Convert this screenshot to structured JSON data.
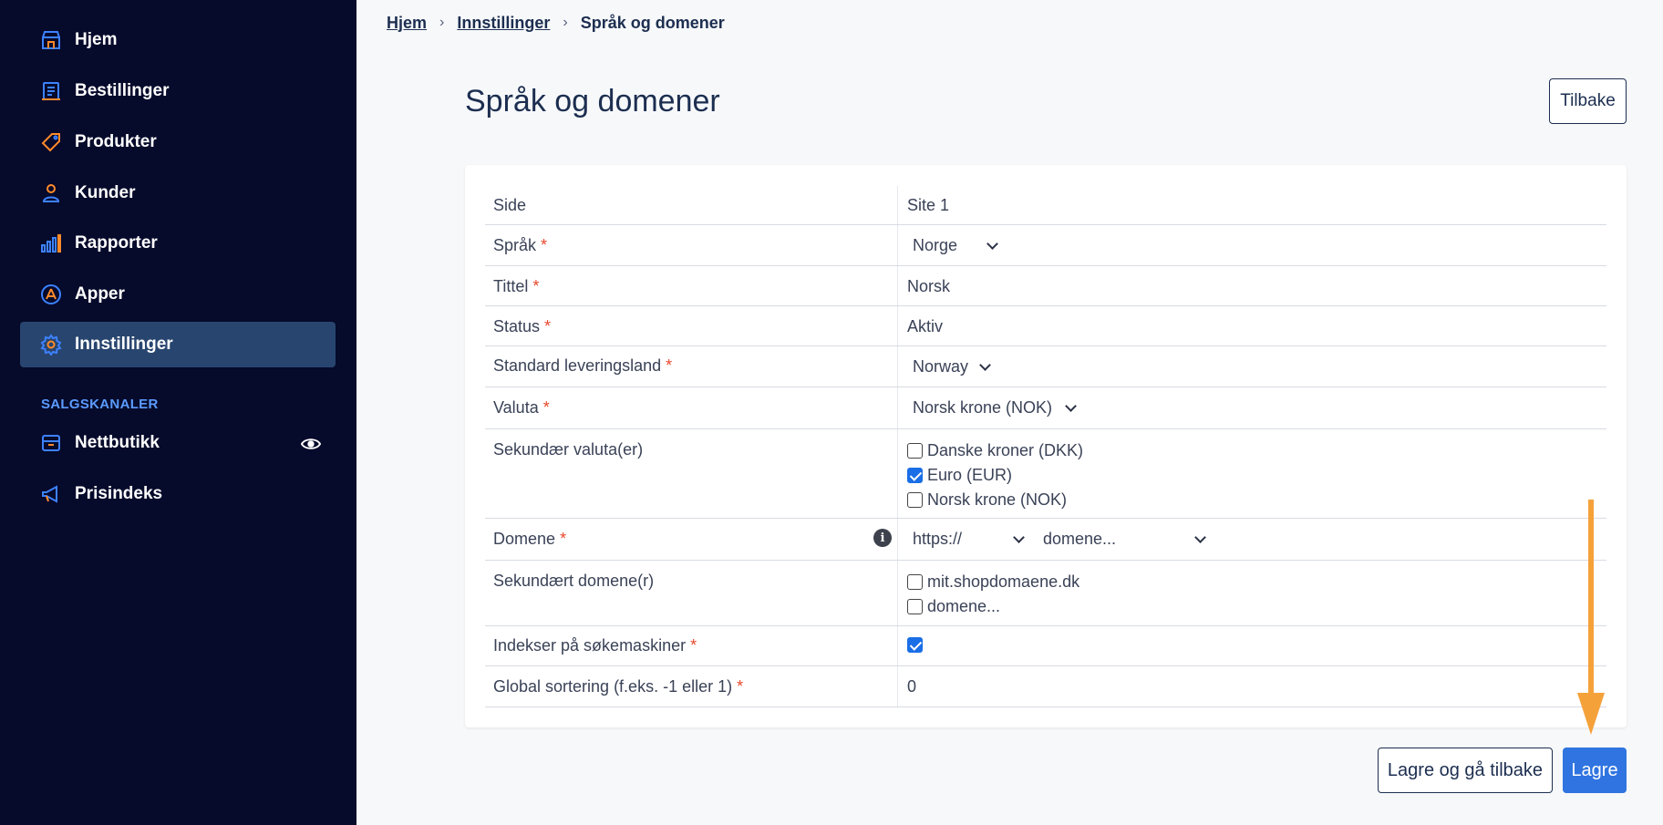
{
  "sidebar": {
    "items": [
      {
        "label": "Hjem",
        "icon": "store-icon"
      },
      {
        "label": "Bestillinger",
        "icon": "orders-icon"
      },
      {
        "label": "Produkter",
        "icon": "tag-icon"
      },
      {
        "label": "Kunder",
        "icon": "user-icon"
      },
      {
        "label": "Rapporter",
        "icon": "bar-chart-icon"
      },
      {
        "label": "Apper",
        "icon": "apps-icon"
      },
      {
        "label": "Innstillinger",
        "icon": "gear-icon",
        "active": true
      }
    ],
    "section_title": "SALGSKANALER",
    "channels": [
      {
        "label": "Nettbutikk",
        "icon": "shop-icon"
      },
      {
        "label": "Prisindeks",
        "icon": "megaphone-icon"
      }
    ]
  },
  "breadcrumb": {
    "home": "Hjem",
    "settings": "Innstillinger",
    "current": "Språk og domener"
  },
  "page": {
    "title": "Språk og domener",
    "back_label": "Tilbake"
  },
  "form": {
    "side": {
      "label": "Side",
      "value": "Site 1"
    },
    "language": {
      "label": "Språk",
      "value": "Norge"
    },
    "title": {
      "label": "Tittel",
      "value": "Norsk"
    },
    "status": {
      "label": "Status",
      "value": "Aktiv"
    },
    "delivery_country": {
      "label": "Standard leveringsland",
      "value": "Norway"
    },
    "currency": {
      "label": "Valuta",
      "value": "Norsk krone (NOK)"
    },
    "secondary_currency": {
      "label": "Sekundær valuta(er)",
      "options": [
        {
          "label": "Danske kroner (DKK)",
          "checked": false
        },
        {
          "label": "Euro (EUR)",
          "checked": true
        },
        {
          "label": "Norsk krone (NOK)",
          "checked": false
        }
      ]
    },
    "domain": {
      "label": "Domene",
      "protocol": "https://",
      "value": "domene..."
    },
    "secondary_domain": {
      "label": "Sekundært domene(r)",
      "options": [
        {
          "label": "mit.shopdomaene.dk",
          "checked": false
        },
        {
          "label": "domene...",
          "checked": false
        }
      ]
    },
    "index": {
      "label": "Indekser på søkemaskiner",
      "checked": true
    },
    "global_sort": {
      "label": "Global sortering (f.eks. -1 eller 1)",
      "value": "0"
    },
    "required_marker": "*"
  },
  "actions": {
    "save_back_label": "Lagre og gå tilbake",
    "save_label": "Lagre"
  },
  "colors": {
    "sidebar_bg": "#060a2b",
    "active_bg": "#28456f",
    "accent": "#2f74e0",
    "icon_blue": "#3d82ff",
    "icon_orange": "#ff8a2a",
    "arrow": "#f5a13a"
  }
}
